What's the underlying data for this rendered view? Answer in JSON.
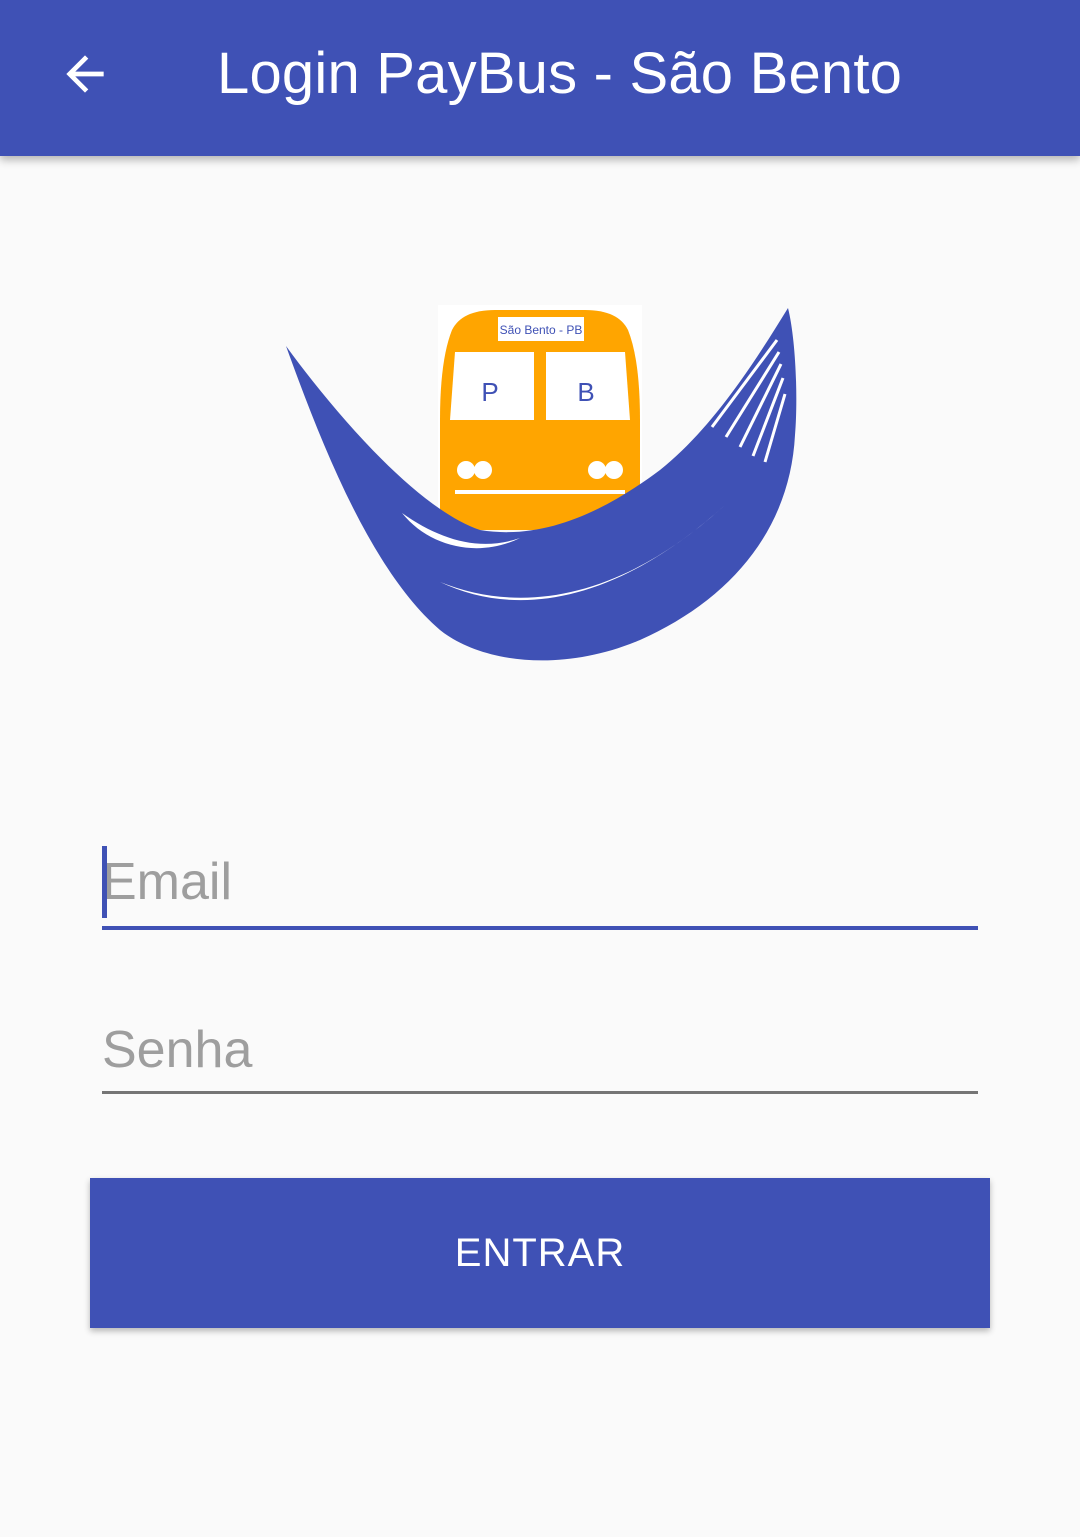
{
  "toolbar": {
    "title": "Login PayBus - São Bento",
    "back_icon": "arrow-left-icon"
  },
  "logo": {
    "bus_sign": "São Bento - PB",
    "window_left": "P",
    "window_right": "B",
    "colors": {
      "hammock": "#3f51b5",
      "bus": "#ffa500"
    }
  },
  "form": {
    "email_placeholder": "Email",
    "email_value": "",
    "password_placeholder": "Senha",
    "password_value": "",
    "submit_label": "ENTRAR"
  },
  "colors": {
    "primary": "#3f51b5",
    "background": "#fafafa",
    "hint": "#9e9e9e",
    "underline_inactive": "#757575"
  }
}
